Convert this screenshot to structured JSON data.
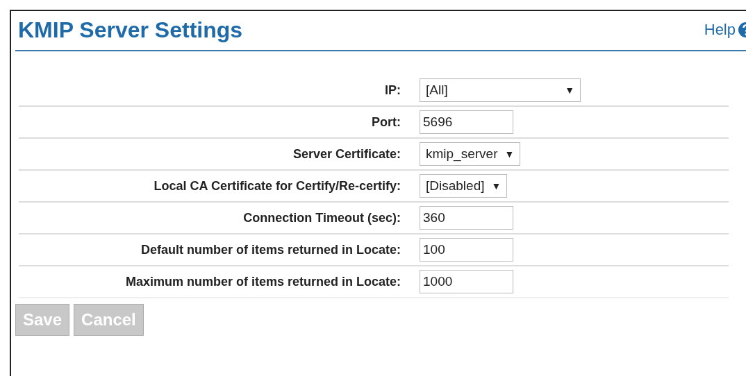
{
  "header": {
    "title": "KMIP Server Settings",
    "help": "Help"
  },
  "fields": [
    {
      "kind": "select",
      "label": "IP:",
      "value": "[All]",
      "arrow": "▼"
    },
    {
      "kind": "text",
      "label": "Port:",
      "value": "5696"
    },
    {
      "kind": "select",
      "label": "Server Certificate:",
      "value": "kmip_server",
      "arrow": "▼"
    },
    {
      "kind": "select",
      "label": "Local CA Certificate for Certify/Re-certify:",
      "value": "[Disabled]",
      "arrow": "▼"
    },
    {
      "kind": "text",
      "label": "Connection Timeout (sec):",
      "value": "360"
    },
    {
      "kind": "text",
      "label": "Default number of items returned in Locate:",
      "value": "100"
    },
    {
      "kind": "text",
      "label": "Maximum number of items returned in Locate:",
      "value": "1000"
    }
  ],
  "buttons": [
    {
      "label": "Save",
      "disabled": true
    },
    {
      "label": "Cancel",
      "disabled": true
    }
  ]
}
